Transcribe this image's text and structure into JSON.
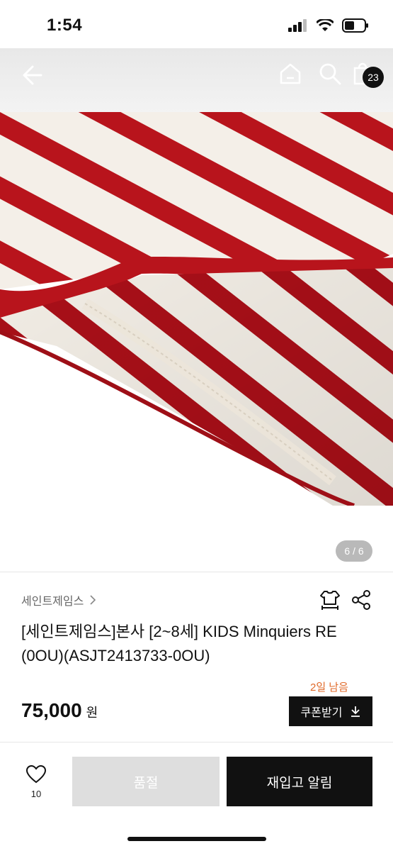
{
  "status": {
    "time": "1:54"
  },
  "topbar": {
    "cart_count": "23",
    "back_icon": "back-arrow-icon",
    "home_icon": "home-icon",
    "search_icon": "search-icon",
    "bag_icon": "shopping-bag-icon"
  },
  "gallery": {
    "page_indicator": "6 / 6",
    "photo_colors": {
      "stripe": "#b8141c",
      "base": "#f4efe8"
    }
  },
  "product": {
    "brand": "세인트제임스",
    "title": "[세인트제임스]본사 [2~8세] KIDS Minquiers RE (0OU)(ASJT2413733-0OU)",
    "deadline": "2일 남음",
    "price": "75,000",
    "currency": "원",
    "coupon_label": "쿠폰받기"
  },
  "bottom": {
    "wish_count": "10",
    "soldout_label": "품절",
    "restock_label": "재입고 알림"
  },
  "colors": {
    "accent": "#e06a2a",
    "primary": "#111111",
    "disabled": "#dedede"
  }
}
